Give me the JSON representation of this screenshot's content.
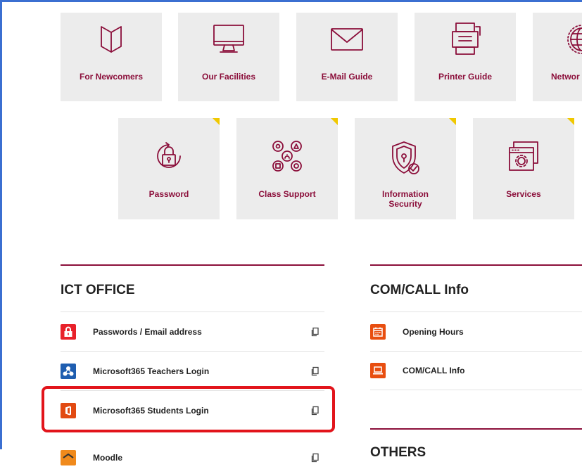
{
  "top_tiles": [
    {
      "label": "For Newcomers",
      "icon": "bookmark-icon"
    },
    {
      "label": "Our Facilities",
      "icon": "monitor-icon"
    },
    {
      "label": "E-Mail Guide",
      "icon": "envelope-icon"
    },
    {
      "label": "Printer Guide",
      "icon": "printer-icon"
    },
    {
      "label": "Networ",
      "icon": "globe-icon"
    }
  ],
  "second_tiles": [
    {
      "label": "Password",
      "icon": "lock-icon"
    },
    {
      "label": "Class Support",
      "icon": "network-icon"
    },
    {
      "label_line1": "Information",
      "label_line2": "Security",
      "icon": "shield-lock-icon"
    },
    {
      "label": "Services",
      "icon": "gear-window-icon"
    }
  ],
  "ict_office": {
    "title": "ICT OFFICE",
    "items": [
      {
        "label": "Passwords / Email address",
        "icon": "lock-icon",
        "color": "#e8212a"
      },
      {
        "label": "Microsoft365 Teachers Login",
        "icon": "teams-icon",
        "color": "#1f5eb0"
      },
      {
        "label": "Microsoft365 Students Login",
        "icon": "office-icon",
        "color": "#e24a12"
      },
      {
        "label": "Moodle",
        "icon": "moodle-icon",
        "color": "#f08a1c"
      }
    ]
  },
  "com_call": {
    "title": "COM/CALL Info",
    "items": [
      {
        "label": "Opening Hours",
        "icon": "calendar-icon",
        "color": "#e84e10"
      },
      {
        "label": "COM/CALL Info",
        "icon": "laptop-icon",
        "color": "#e84e10"
      }
    ]
  },
  "others": {
    "title": "OTHERS"
  },
  "colors": {
    "accent": "#8b0e3a",
    "tile_bg": "#ececec",
    "highlight": "#e2141b",
    "corner": "#f0c800"
  }
}
